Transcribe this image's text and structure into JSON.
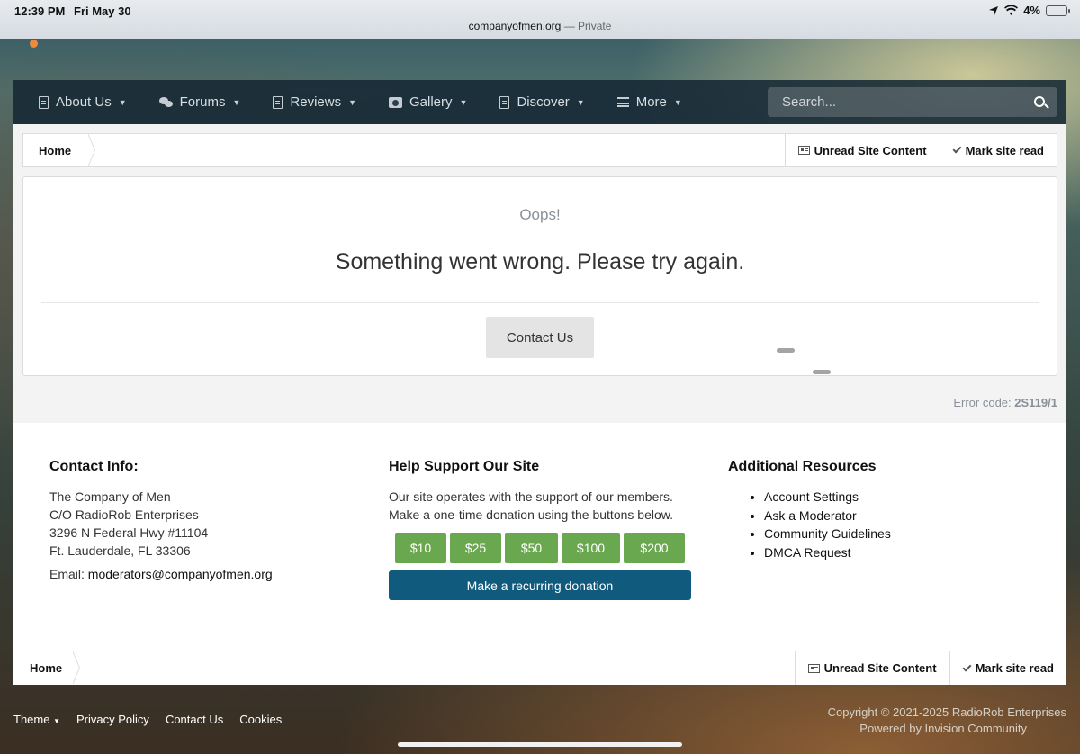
{
  "status_bar": {
    "time": "12:39 PM",
    "date": "Fri May 30",
    "battery": "4%",
    "battery_level": 0.04
  },
  "url_bar": {
    "domain": "companyofmen.org",
    "mode": "— Private"
  },
  "nav": {
    "items": [
      {
        "label": "About Us",
        "icon": "document-icon"
      },
      {
        "label": "Forums",
        "icon": "comments-icon"
      },
      {
        "label": "Reviews",
        "icon": "document-icon"
      },
      {
        "label": "Gallery",
        "icon": "camera-icon"
      },
      {
        "label": "Discover",
        "icon": "document-icon"
      },
      {
        "label": "More",
        "icon": "menu-bars-icon"
      }
    ],
    "search_placeholder": "Search..."
  },
  "breadcrumb": {
    "home": "Home",
    "unread": "Unread Site Content",
    "mark_read": "Mark site read"
  },
  "error": {
    "oops": "Oops!",
    "message": "Something went wrong. Please try again.",
    "contact_button": "Contact Us",
    "code_label": "Error code:",
    "code_value": "2S119/1"
  },
  "footer": {
    "contact": {
      "heading": "Contact Info:",
      "address": [
        "The Company of Men",
        "C/O RadioRob Enterprises",
        "3296 N Federal Hwy #11104",
        "Ft. Lauderdale, FL 33306"
      ],
      "email_label": "Email:",
      "email": "moderators@companyofmen.org"
    },
    "support": {
      "heading": "Help Support Our Site",
      "text": "Our site operates with the support of our members. Make a one-time donation using the buttons below.",
      "amounts": [
        "$10",
        "$25",
        "$50",
        "$100",
        "$200"
      ],
      "recurring": "Make a recurring donation"
    },
    "resources": {
      "heading": "Additional Resources",
      "links": [
        "Account Settings",
        "Ask a Moderator",
        "Community Guidelines",
        "DMCA Request"
      ]
    }
  },
  "page_footer": {
    "links": [
      "Theme",
      "Privacy Policy",
      "Contact Us",
      "Cookies"
    ],
    "copyright": "Copyright © 2021-2025 RadioRob Enterprises",
    "powered": "Powered by Invision Community"
  },
  "colors": {
    "nav_bg": "#162834",
    "donate_green": "#6aa84f",
    "recurring_blue": "#0f5a7d"
  }
}
